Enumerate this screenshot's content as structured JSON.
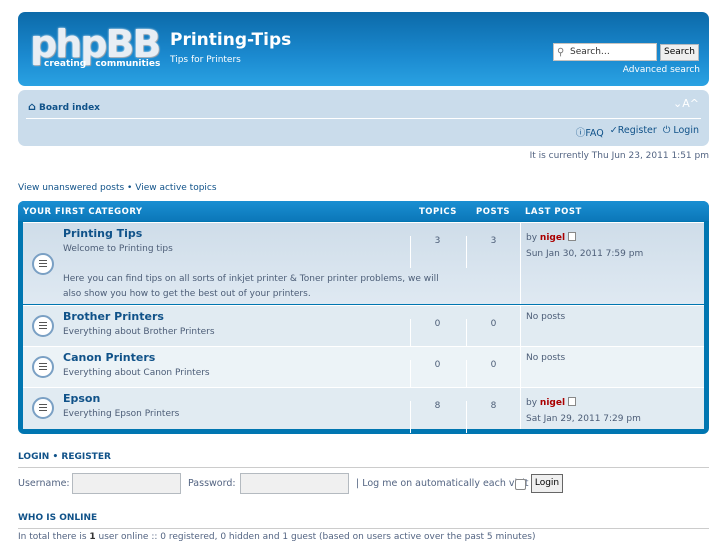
{
  "header": {
    "logo_text": "phpBB",
    "logo_tagline": "creating communities",
    "site_title": "Printing-Tips",
    "site_description": "Tips for Printers",
    "search_placeholder": "Search…",
    "search_button": "Search",
    "advanced_search": "Advanced search"
  },
  "navbar": {
    "board_index": "Board index",
    "font_size": "⌄A^",
    "faq": "FAQ",
    "register": "Register",
    "login": "Login"
  },
  "current_time": "It is currently Thu Jun 23, 2011 1:51 pm",
  "quick_links": {
    "unanswered": "View unanswered posts",
    "separator": "•",
    "active": "View active topics"
  },
  "category": {
    "title": "YOUR FIRST CATEGORY",
    "col_topics": "TOPICS",
    "col_posts": "POSTS",
    "col_last_post": "LAST POST"
  },
  "forums": [
    {
      "name": "Printing Tips",
      "desc": "Welcome to Printing tips",
      "desc2": "Here you can find tips on all sorts of inkjet printer & Toner printer problems, we will also show you how to get the best out of your printers.",
      "topics": "3",
      "posts": "3",
      "by": "by",
      "author": "nigel",
      "date": "Sun Jan 30, 2011 7:59 pm"
    },
    {
      "name": "Brother Printers",
      "desc": "Everything about Brother Printers",
      "topics": "0",
      "posts": "0",
      "no_posts": "No posts"
    },
    {
      "name": "Canon Printers",
      "desc": "Everything about Canon Printers",
      "topics": "0",
      "posts": "0",
      "no_posts": "No posts"
    },
    {
      "name": "Epson",
      "desc": "Everything Epson Printers",
      "topics": "8",
      "posts": "8",
      "by": "by",
      "author": "nigel",
      "date": "Sat Jan 29, 2011 7:29 pm"
    }
  ],
  "login": {
    "heading_login": "LOGIN",
    "sep": "•",
    "heading_register": "REGISTER",
    "username_label": "Username:",
    "username_value": "",
    "password_label": "Password:",
    "password_value": "",
    "autologin": "| Log me on automatically each visit",
    "button": "Login"
  },
  "online": {
    "heading": "WHO IS ONLINE",
    "prefix": "In total there is ",
    "count": "1",
    "suffix": " user online :: 0 registered, 0 hidden and 1 guest (based on users active over the past 5 minutes)"
  }
}
